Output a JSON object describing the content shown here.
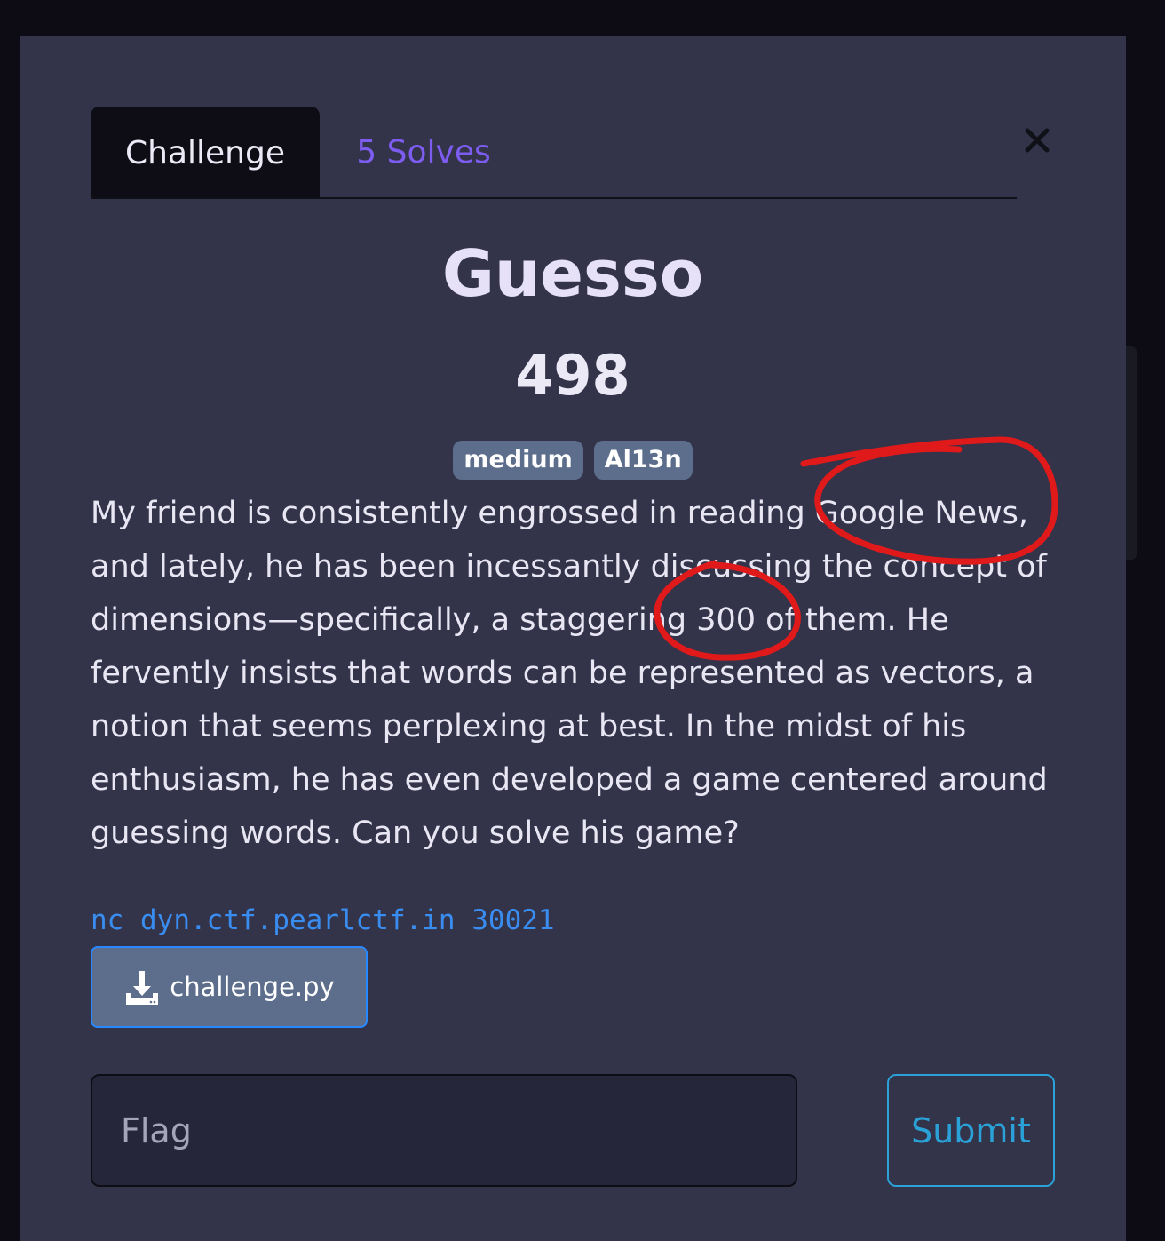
{
  "tabs": {
    "challenge_label": "Challenge",
    "solves_label": "5 Solves"
  },
  "close_icon": "close-icon",
  "challenge": {
    "title": "Guesso",
    "points": "498",
    "tags": [
      "medium",
      "Al13n"
    ],
    "description": "My friend is consistently engrossed in reading Google News, and lately, he has been incessantly discussing the concept of dimensions—specifically, a staggering 300 of them. He fervently insists that words can be represented as vectors, a notion that seems perplexing at best. In the midst of his enthusiasm, he has even developed a game centered around guessing words. Can you solve his game?",
    "connection": "nc dyn.ctf.pearlctf.in 30021",
    "file_name": "challenge.py",
    "file_icon": "download-icon"
  },
  "form": {
    "flag_placeholder": "Flag",
    "flag_value": "",
    "submit_label": "Submit"
  },
  "colors": {
    "modal_bg": "#33334a",
    "active_tab_bg": "#0e0d16",
    "solves_tab": "#7d5cf0",
    "tag_bg": "#5c6e8c",
    "link_blue": "#3a8df0",
    "submit_accent": "#2aa2d8",
    "annotation_red": "#e01a1a"
  }
}
